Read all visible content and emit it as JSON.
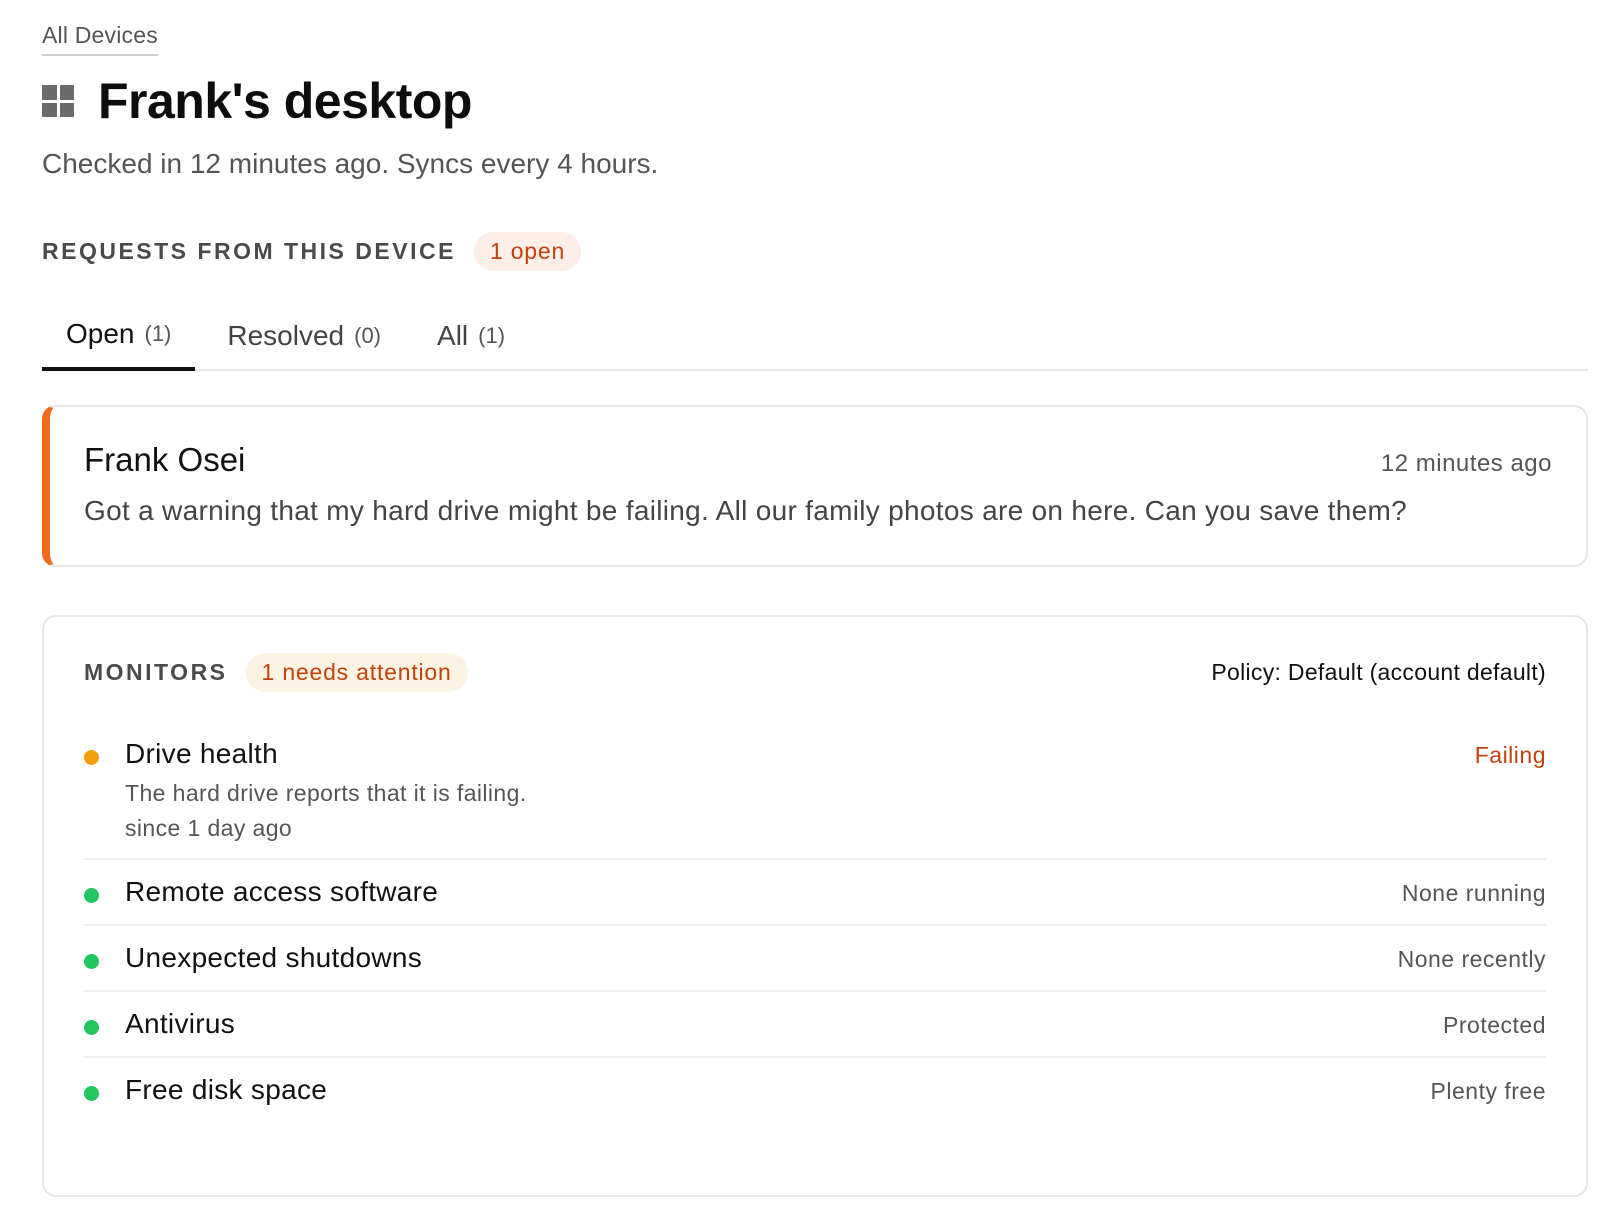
{
  "breadcrumb": "All Devices",
  "device": {
    "icon": "windows-icon",
    "name": "Frank's desktop",
    "subtitle": "Checked in 12 minutes ago. Syncs every 4 hours."
  },
  "requests": {
    "section_label": "REQUESTS FROM THIS DEVICE",
    "badge": "1 open",
    "tabs": [
      {
        "label": "Open",
        "count": "(1)",
        "active": true
      },
      {
        "label": "Resolved",
        "count": "(0)",
        "active": false
      },
      {
        "label": "All",
        "count": "(1)",
        "active": false
      }
    ],
    "items": [
      {
        "name": "Frank Osei",
        "time": "12 minutes ago",
        "message": "Got a warning that my hard drive might be failing. All our family photos are on here. Can you save them?",
        "accent_color": "#f26b1d"
      }
    ]
  },
  "monitors": {
    "section_label": "MONITORS",
    "badge": "1 needs attention",
    "policy": "Policy: Default (account default)",
    "items": [
      {
        "name": "Drive health",
        "detail": "The hard drive reports that it is failing.",
        "since": "since 1 day ago",
        "status": "Failing",
        "dot_color": "#f59e0b",
        "status_color": "#c2410c"
      },
      {
        "name": "Remote access software",
        "status": "None running",
        "dot_color": "#22c55e",
        "status_color": "#555555"
      },
      {
        "name": "Unexpected shutdowns",
        "status": "None recently",
        "dot_color": "#22c55e",
        "status_color": "#555555"
      },
      {
        "name": "Antivirus",
        "status": "Protected",
        "dot_color": "#22c55e",
        "status_color": "#555555"
      },
      {
        "name": "Free disk space",
        "status": "Plenty free",
        "dot_color": "#22c55e",
        "status_color": "#555555"
      }
    ]
  }
}
